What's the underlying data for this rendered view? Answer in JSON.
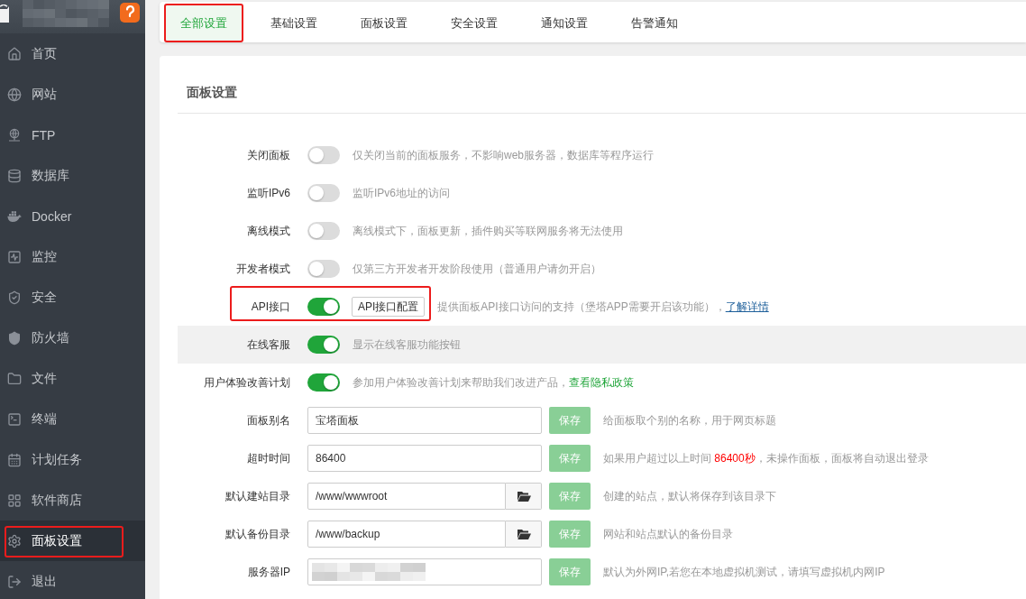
{
  "sidebar": {
    "items": [
      {
        "label": "首页",
        "selected": false,
        "annotated": false
      },
      {
        "label": "网站",
        "selected": false,
        "annotated": false
      },
      {
        "label": "FTP",
        "selected": false,
        "annotated": false
      },
      {
        "label": "数据库",
        "selected": false,
        "annotated": false
      },
      {
        "label": "Docker",
        "selected": false,
        "annotated": false
      },
      {
        "label": "监控",
        "selected": false,
        "annotated": false
      },
      {
        "label": "安全",
        "selected": false,
        "annotated": false
      },
      {
        "label": "防火墙",
        "selected": false,
        "annotated": false
      },
      {
        "label": "文件",
        "selected": false,
        "annotated": false
      },
      {
        "label": "终端",
        "selected": false,
        "annotated": false
      },
      {
        "label": "计划任务",
        "selected": false,
        "annotated": false
      },
      {
        "label": "软件商店",
        "selected": false,
        "annotated": false
      },
      {
        "label": "面板设置",
        "selected": true,
        "annotated": true
      },
      {
        "label": "退出",
        "selected": false,
        "annotated": false
      }
    ]
  },
  "tabs": [
    {
      "label": "全部设置",
      "selected": true,
      "annotated": true
    },
    {
      "label": "基础设置",
      "selected": false,
      "annotated": false
    },
    {
      "label": "面板设置",
      "selected": false,
      "annotated": false
    },
    {
      "label": "安全设置",
      "selected": false,
      "annotated": false
    },
    {
      "label": "通知设置",
      "selected": false,
      "annotated": false
    },
    {
      "label": "告警通知",
      "selected": false,
      "annotated": false
    }
  ],
  "section": {
    "title": "面板设置"
  },
  "settings": [
    {
      "kind": "toggle",
      "label": "关闭面板",
      "on": false,
      "hovered": false,
      "annotated": false,
      "description": "仅关闭当前的面板服务，不影响web服务器，数据库等程序运行"
    },
    {
      "kind": "toggle",
      "label": "监听IPv6",
      "on": false,
      "hovered": false,
      "annotated": false,
      "description": "监听IPv6地址的访问"
    },
    {
      "kind": "toggle",
      "label": "离线模式",
      "on": false,
      "hovered": false,
      "annotated": false,
      "description": "离线模式下，面板更新，插件购买等联网服务将无法使用"
    },
    {
      "kind": "toggle",
      "label": "开发者模式",
      "on": false,
      "hovered": false,
      "annotated": false,
      "description": "仅第三方开发者开发阶段使用（普通用户请勿开启）"
    },
    {
      "kind": "toggle",
      "label": "API接口",
      "on": true,
      "hovered": false,
      "annotated": true,
      "button": {
        "label": "API接口配置"
      },
      "description": "提供面板API接口访问的支持（堡塔APP需要开启该功能），",
      "link": {
        "text": "了解详情",
        "kind": "help"
      }
    },
    {
      "kind": "toggle",
      "label": "在线客服",
      "on": true,
      "hovered": true,
      "annotated": false,
      "description": "显示在线客服功能按钮"
    },
    {
      "kind": "toggle",
      "label": "用户体验改善计划",
      "on": true,
      "hovered": false,
      "annotated": false,
      "description": "参加用户体验改善计划来帮助我们改进产品，",
      "link": {
        "text": "查看隐私政策",
        "kind": "policy"
      }
    },
    {
      "kind": "input",
      "label": "面板别名",
      "value": "宝塔面板",
      "redacted": false,
      "hovered": false,
      "annotated": false,
      "save": {
        "label": "保存",
        "disabled": true
      },
      "description": "给面板取个别的名称，用于网页标题"
    },
    {
      "kind": "input",
      "label": "超时时间",
      "value": "86400",
      "redacted": false,
      "hovered": false,
      "annotated": false,
      "save": {
        "label": "保存",
        "disabled": true
      },
      "description": "如果用户超过以上时间 **86400秒**，未操作面板，面板将自动退出登录"
    },
    {
      "kind": "path",
      "label": "默认建站目录",
      "value": "/www/wwwroot",
      "redacted": false,
      "hovered": false,
      "annotated": false,
      "save": {
        "label": "保存",
        "disabled": true
      },
      "description": "创建的站点，默认将保存到该目录下"
    },
    {
      "kind": "path",
      "label": "默认备份目录",
      "value": "/www/backup",
      "redacted": false,
      "hovered": false,
      "annotated": false,
      "save": {
        "label": "保存",
        "disabled": true
      },
      "description": "网站和站点默认的备份目录"
    },
    {
      "kind": "input",
      "label": "服务器IP",
      "redacted": true,
      "hovered": false,
      "annotated": false,
      "save": {
        "label": "保存",
        "disabled": true
      },
      "description": "默认为外网IP,若您在本地虚拟机测试，请填写虚拟机内网IP"
    }
  ]
}
